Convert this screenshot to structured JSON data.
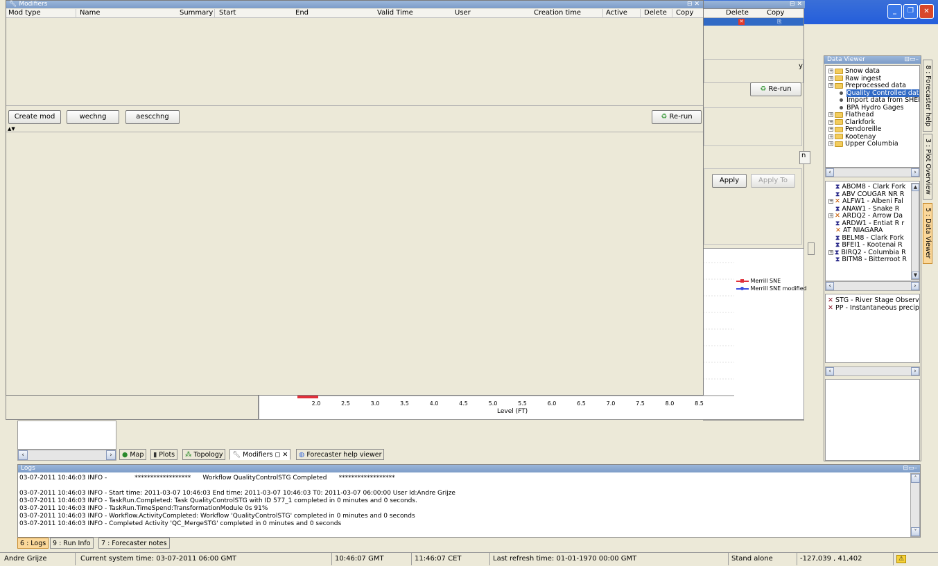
{
  "modifiers_window": {
    "title": "Modifiers",
    "columns": [
      "Mod type",
      "Name",
      "Summary",
      "Start",
      "End",
      "Valid Time",
      "User",
      "Creation time",
      "Active",
      "Delete",
      "Copy"
    ],
    "buttons": {
      "create_mod": "Create mod",
      "wechng": "wechng",
      "aescchng": "aescchng",
      "rerun": "Re-run"
    }
  },
  "second_window": {
    "columns": [
      "Delete",
      "Copy"
    ],
    "rerun": "Re-run",
    "apply": "Apply",
    "apply_to": "Apply To",
    "partial_y": "y",
    "partial_n": "n"
  },
  "chart_data": {
    "type": "line",
    "xlabel": "Level (FT)",
    "x_ticks": [
      "2.0",
      "2.5",
      "3.0",
      "3.5",
      "4.0",
      "4.5",
      "5.0",
      "5.5",
      "6.0",
      "6.5",
      "7.0",
      "7.5",
      "8.0",
      "8.5"
    ],
    "series": [
      {
        "name": "Merrill SNE",
        "color": "#e0303a"
      },
      {
        "name": "Merrill SNE modified",
        "color": "#3a4ce0"
      }
    ]
  },
  "data_viewer": {
    "title": "Data Viewer",
    "tree": [
      {
        "label": "Snow data",
        "type": "folder"
      },
      {
        "label": "Raw ingest",
        "type": "folder"
      },
      {
        "label": "Preprocessed data",
        "type": "folder"
      },
      {
        "label": "Quality Controlled data",
        "type": "leaf",
        "selected": true
      },
      {
        "label": "Import data from SHEF",
        "type": "leaf"
      },
      {
        "label": "BPA Hydro Gages",
        "type": "leaf"
      },
      {
        "label": "Flathead",
        "type": "folder"
      },
      {
        "label": "Clarkfork",
        "type": "folder"
      },
      {
        "label": "Pendoreille",
        "type": "folder"
      },
      {
        "label": "Kootenay",
        "type": "folder"
      },
      {
        "label": "Upper Columbia",
        "type": "folder"
      }
    ],
    "locations": [
      {
        "label": "ABOM8 - Clark Fork",
        "expand": false,
        "mark": "hourglass"
      },
      {
        "label": "ABV COUGAR NR R",
        "expand": false,
        "mark": "hourglass"
      },
      {
        "label": "ALFW1 - Albeni Fal",
        "expand": true,
        "mark": "x"
      },
      {
        "label": "ANAW1 - Snake R",
        "expand": false,
        "mark": "hourglass"
      },
      {
        "label": "ARDQ2 - Arrow Da",
        "expand": true,
        "mark": "x"
      },
      {
        "label": "ARDW1 - Entiat R r",
        "expand": false,
        "mark": "hourglass"
      },
      {
        "label": "AT NIAGARA",
        "expand": false,
        "mark": "x"
      },
      {
        "label": "BELM8 - Clark Fork",
        "expand": false,
        "mark": "hourglass"
      },
      {
        "label": "BFEI1 - Kootenai R",
        "expand": false,
        "mark": "hourglass"
      },
      {
        "label": "BIRQ2 - Columbia R",
        "expand": true,
        "mark": "hourglass"
      },
      {
        "label": "BITM8 - Bitterroot R",
        "expand": false,
        "mark": "hourglass"
      }
    ],
    "parameters": [
      "STG - River Stage Observe",
      "PP - Instantaneous precipit"
    ]
  },
  "side_tabs": [
    {
      "label": "8 : Forecaster help"
    },
    {
      "label": "3 : Plot Overview"
    },
    {
      "label": "5 : Data Viewer"
    }
  ],
  "bottom_tabs": [
    "Map",
    "Plots",
    "Topology",
    "Modifiers",
    "Forecaster help viewer"
  ],
  "logs": {
    "title": "Logs",
    "lines": [
      "03-07-2011 10:46:03 INFO -              ******************      Workflow QualityControlSTG Completed      ******************",
      "",
      "03-07-2011 10:46:03 INFO - Start time: 2011-03-07 10:46:03 End time: 2011-03-07 10:46:03 T0: 2011-03-07 06:00:00 User Id:Andre Grijze",
      "03-07-2011 10:46:03 INFO - TaskRun.Completed: Task QualityControlSTG with ID 577_1 completed in 0 minutes and 0 seconds.",
      "03-07-2011 10:46:03 INFO - TaskRun.TimeSpend:TransformationModule 0s 91%",
      "03-07-2011 10:46:03 INFO - Workflow.ActivityCompleted: Workflow 'QualityControlSTG' completed in 0 minutes and 0 seconds",
      "03-07-2011 10:46:03 INFO - Completed Activity 'QC_MergeSTG' completed in 0 minutes and 0 seconds"
    ],
    "tabs": [
      "6 : Logs",
      "9 : Run Info",
      "7 : Forecaster notes"
    ]
  },
  "status_bar": {
    "user": "Andre Grijze",
    "system_time": "Current system time: 03-07-2011 06:00 GMT",
    "gmt": "10:46:07 GMT",
    "cet": "11:46:07 CET",
    "refresh": "Last refresh time: 01-01-1970 00:00 GMT",
    "mode": "Stand alone",
    "coords": "-127,039 , 41,402"
  },
  "colors": {
    "accent_blue": "#316ac5",
    "title_blue": "#7d9cc8",
    "series_red": "#e0303a",
    "series_blue": "#3a4ce0"
  }
}
